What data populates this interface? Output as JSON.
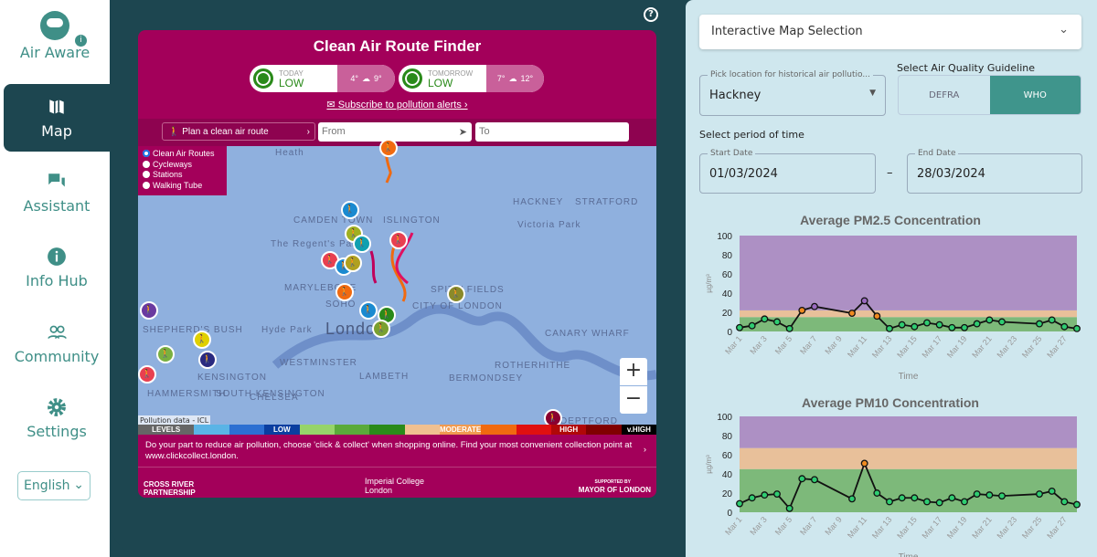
{
  "sidebar": {
    "brand": "Air Aware",
    "items": [
      {
        "label": "Map",
        "icon": "map-icon",
        "active": true
      },
      {
        "label": "Assistant",
        "icon": "chat-icon"
      },
      {
        "label": "Info Hub",
        "icon": "info-icon"
      },
      {
        "label": "Community",
        "icon": "people-icon"
      },
      {
        "label": "Settings",
        "icon": "gear-icon"
      }
    ],
    "language": "English"
  },
  "widget": {
    "title": "Clean Air Route Finder",
    "today": {
      "label": "TODAY",
      "level": "LOW",
      "low": "4°",
      "high": "9°"
    },
    "tomorrow": {
      "label": "TOMORROW",
      "level": "LOW",
      "low": "7°",
      "high": "12°"
    },
    "subscribe": "Subscribe to pollution alerts ›",
    "plan": "Plan a clean air route",
    "from_placeholder": "From",
    "to_placeholder": "To",
    "layers": [
      "Clean Air Routes",
      "Cycleways",
      "Stations",
      "Walking Tube"
    ],
    "map_labels": [
      "Heath",
      "CAMDEN TOWN",
      "ISLINGTON",
      "HACKNEY",
      "Victoria Park",
      "STRATFORD",
      "The Regent's Park",
      "MARYLEBONE",
      "SOHO",
      "SPITALFIELDS",
      "CITY OF LONDON",
      "London",
      "Hyde Park",
      "WESTMINSTER",
      "LAMBETH",
      "BERMONDSEY",
      "ROTHERHITHE",
      "CANARY WHARF",
      "KENSINGTON",
      "SOUTH KENSINGTON",
      "CHELSEA",
      "SHEPHERD'S BUSH",
      "HAMMERSMITH",
      "DEPTFORD"
    ],
    "attribution": "Pollution data - ICL",
    "levels": [
      "LEVELS",
      "",
      "",
      "LOW",
      "",
      "",
      "",
      "",
      "MODERATE",
      "",
      "",
      "HIGH",
      "",
      "v.HIGH"
    ],
    "level_colors": [
      "#666",
      "#5ab4e6",
      "#2c6fd2",
      "#0a3ea0",
      "#96d46a",
      "#5aaa3a",
      "#2a8a1a",
      "#f0c090",
      "#f09a50",
      "#f06a10",
      "#e01010",
      "#b00808",
      "#800000",
      "#000000"
    ],
    "tip": "Do your part to reduce air pollution, choose 'click & collect' when shopping online. Find your most convenient collection point at www.clickcollect.london.",
    "footer": {
      "left": "CROSS RIVER PARTNERSHIP",
      "center": "Imperial College London",
      "right_small": "SUPPORTED BY",
      "right": "MAYOR OF LONDON"
    },
    "accent": "#a3005a"
  },
  "panel": {
    "selection": "Interactive Map Selection",
    "location_label": "Pick location for historical air pollutio...",
    "location": "Hackney",
    "guideline_label": "Select Air Quality Guideline",
    "guidelines": [
      "DEFRA",
      "WHO"
    ],
    "guideline_selected": "WHO",
    "period_label": "Select period of time",
    "start_label": "Start Date",
    "start": "01/03/2024",
    "end_label": "End Date",
    "end": "28/03/2024",
    "dash": "–"
  },
  "chart_data": [
    {
      "type": "line",
      "title": "Average PM2.5 Concentration",
      "xlabel": "Time",
      "ylabel": "µg/m³",
      "ylim": [
        0,
        100
      ],
      "yticks": [
        0,
        20,
        40,
        60,
        80,
        100
      ],
      "xticks": [
        "Mar 1",
        "Mar 3",
        "Mar 5",
        "Mar 7",
        "Mar 9",
        "Mar 11",
        "Mar 13",
        "Mar 15",
        "Mar 17",
        "Mar 19",
        "Mar 21",
        "Mar 23",
        "Mar 25",
        "Mar 27"
      ],
      "bands": [
        {
          "from": 0,
          "to": 15,
          "color": "#7db97a"
        },
        {
          "from": 15,
          "to": 22,
          "color": "#e8c09a"
        },
        {
          "from": 22,
          "to": 100,
          "color": "#ad90c4"
        }
      ],
      "x": [
        1,
        2,
        3,
        4,
        5,
        6,
        7,
        10,
        11,
        12,
        13,
        14,
        15,
        16,
        17,
        18,
        19,
        20,
        21,
        22,
        25,
        26,
        27,
        28
      ],
      "values": [
        4,
        6,
        13,
        10,
        3,
        22,
        26,
        19,
        32,
        16,
        3,
        7,
        5,
        9,
        7,
        4,
        4,
        8,
        12,
        10,
        8,
        12,
        5,
        3
      ]
    },
    {
      "type": "line",
      "title": "Average PM10 Concentration",
      "xlabel": "Time",
      "ylabel": "µg/m³",
      "ylim": [
        0,
        100
      ],
      "yticks": [
        0,
        20,
        40,
        60,
        80,
        100
      ],
      "xticks": [
        "Mar 1",
        "Mar 3",
        "Mar 5",
        "Mar 7",
        "Mar 9",
        "Mar 11",
        "Mar 13",
        "Mar 15",
        "Mar 17",
        "Mar 19",
        "Mar 21",
        "Mar 23",
        "Mar 25",
        "Mar 27"
      ],
      "bands": [
        {
          "from": 0,
          "to": 45,
          "color": "#7db97a"
        },
        {
          "from": 45,
          "to": 67,
          "color": "#e8c09a"
        },
        {
          "from": 67,
          "to": 100,
          "color": "#ad90c4"
        }
      ],
      "x": [
        1,
        2,
        3,
        4,
        5,
        6,
        7,
        10,
        11,
        12,
        13,
        14,
        15,
        16,
        17,
        18,
        19,
        20,
        21,
        22,
        25,
        26,
        27,
        28
      ],
      "values": [
        9,
        15,
        18,
        19,
        4,
        35,
        34,
        14,
        51,
        20,
        11,
        15,
        15,
        11,
        10,
        15,
        11,
        19,
        18,
        17,
        19,
        22,
        11,
        8
      ]
    }
  ]
}
